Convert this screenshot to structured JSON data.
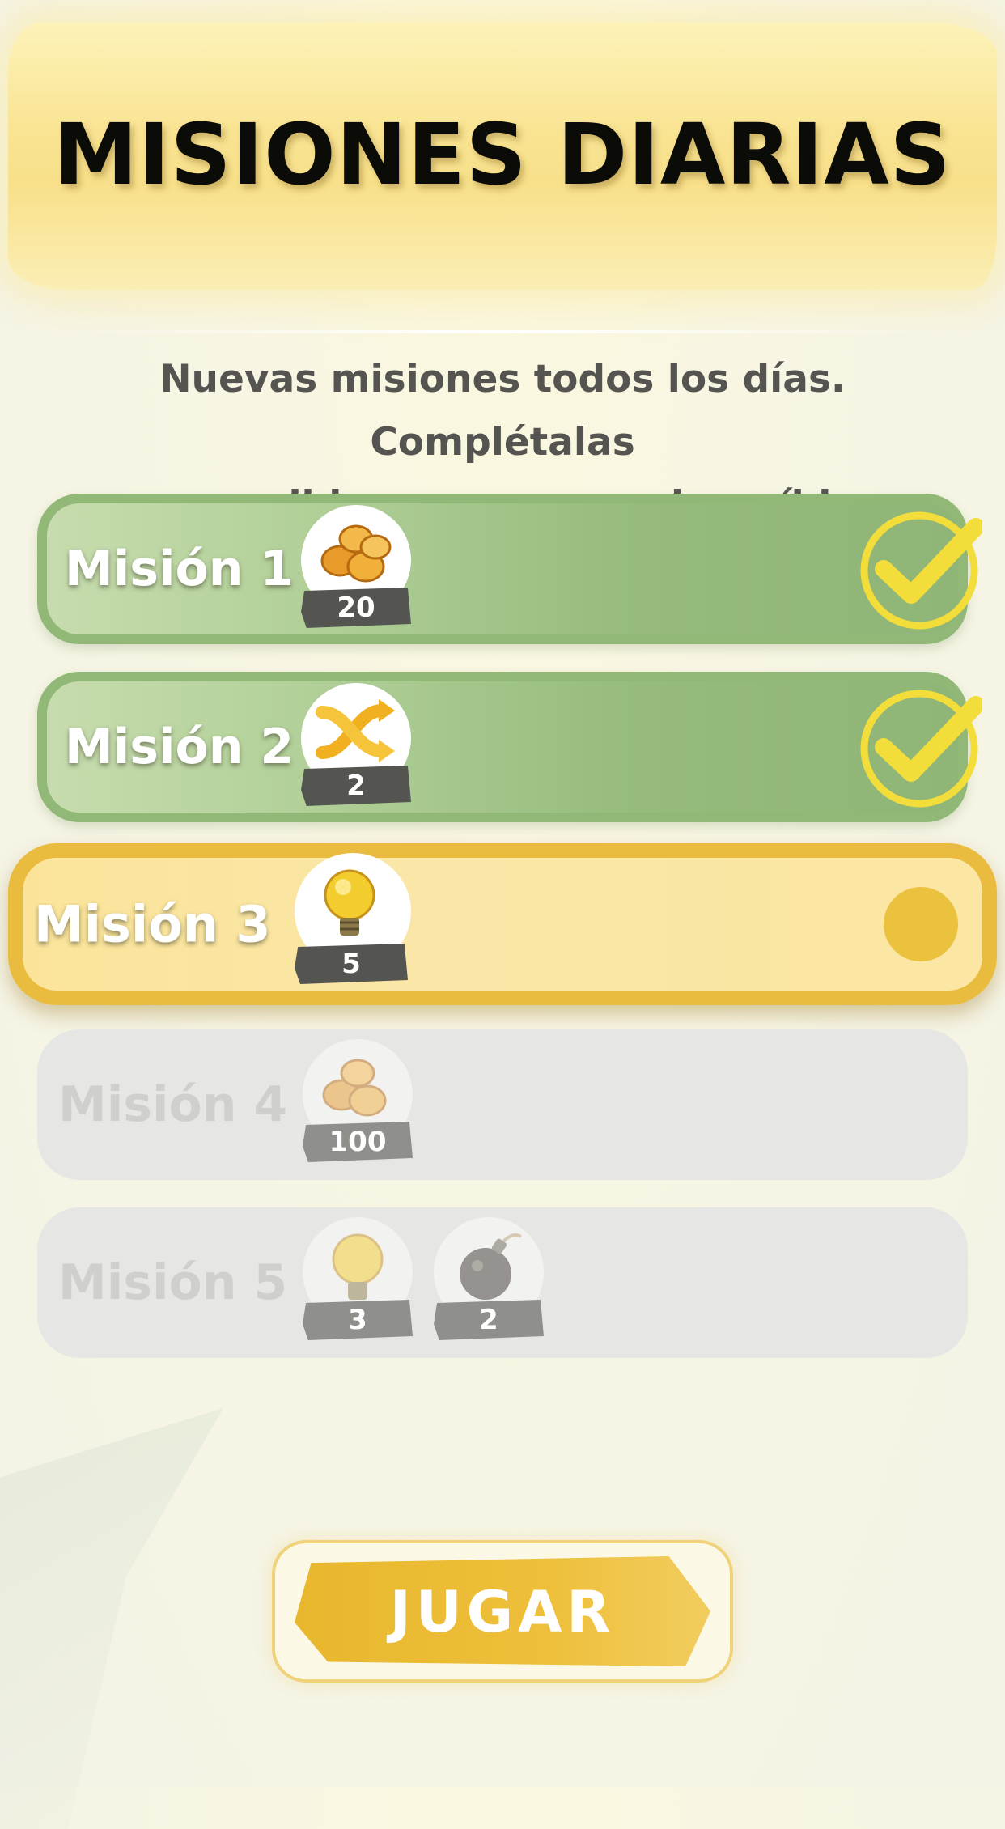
{
  "title": "MISIONES DIARIAS",
  "subtitle_lines": [
    "Nuevas misiones todos los días. Complétalas",
    "para recibir recompensas increíbles."
  ],
  "missions": [
    {
      "label": "Misión 1",
      "state": "completed",
      "rewards": [
        {
          "icon": "coins-icon",
          "amount": "20"
        }
      ]
    },
    {
      "label": "Misión 2",
      "state": "completed",
      "rewards": [
        {
          "icon": "shuffle-icon",
          "amount": "2"
        }
      ]
    },
    {
      "label": "Misión 3",
      "state": "in-progress",
      "rewards": [
        {
          "icon": "lightbulb-icon",
          "amount": "5"
        }
      ]
    },
    {
      "label": "Misión 4",
      "state": "locked",
      "rewards": [
        {
          "icon": "coins-icon",
          "amount": "100"
        }
      ]
    },
    {
      "label": "Misión 5",
      "state": "locked",
      "rewards": [
        {
          "icon": "lightbulb-icon",
          "amount": "3"
        },
        {
          "icon": "bomb-icon",
          "amount": "2"
        }
      ]
    }
  ],
  "play_button_label": "JUGAR",
  "colors": {
    "completed": "#96bb7c",
    "current_border": "#e9bb3e",
    "locked": "#e6e6e4",
    "check": "#f3dd3a"
  }
}
